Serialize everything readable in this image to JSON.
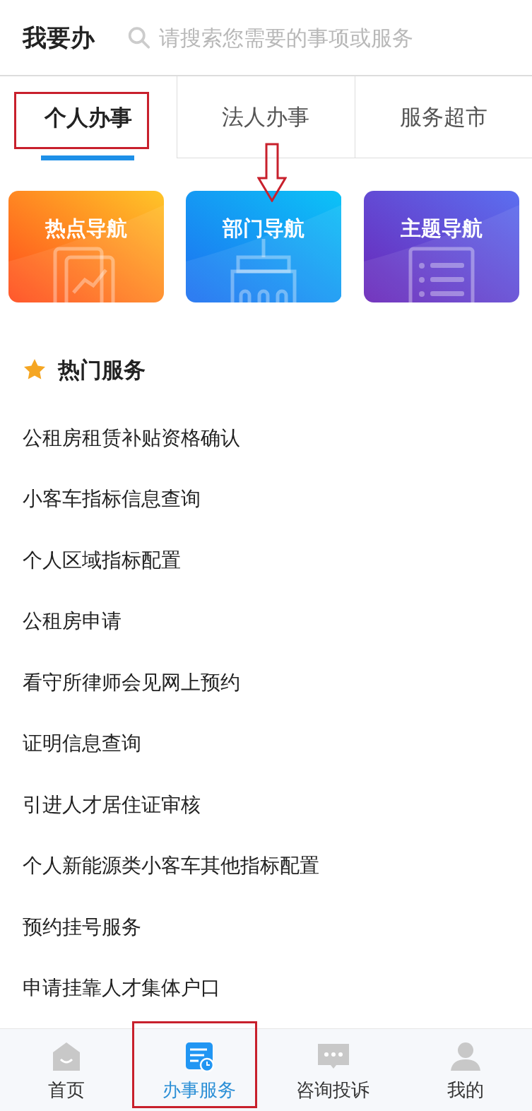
{
  "header": {
    "title": "我要办",
    "search": {
      "placeholder": "请搜索您需要的事项或服务"
    }
  },
  "tabs": [
    {
      "label": "个人办事",
      "selected": true,
      "highlighted": true
    },
    {
      "label": "法人办事",
      "selected": false,
      "highlighted": false
    },
    {
      "label": "服务超市",
      "selected": false,
      "highlighted": false
    }
  ],
  "nav_cards": [
    {
      "label": "热点导航",
      "arrow": false
    },
    {
      "label": "部门导航",
      "arrow": true
    },
    {
      "label": "主题导航",
      "arrow": false
    }
  ],
  "hot_services": {
    "title": "热门服务",
    "items": [
      "公租房租赁补贴资格确认",
      "小客车指标信息查询",
      "个人区域指标配置",
      "公租房申请",
      "看守所律师会见网上预约",
      "证明信息查询",
      "引进人才居住证审核",
      "个人新能源类小客车其他指标配置",
      "预约挂号服务",
      "申请挂靠人才集体户口"
    ]
  },
  "bottom_nav": [
    {
      "label": "首页",
      "selected": false,
      "highlighted": false
    },
    {
      "label": "办事服务",
      "selected": true,
      "highlighted": true
    },
    {
      "label": "咨询投诉",
      "selected": false,
      "highlighted": false
    },
    {
      "label": "我的",
      "selected": false,
      "highlighted": false
    }
  ]
}
